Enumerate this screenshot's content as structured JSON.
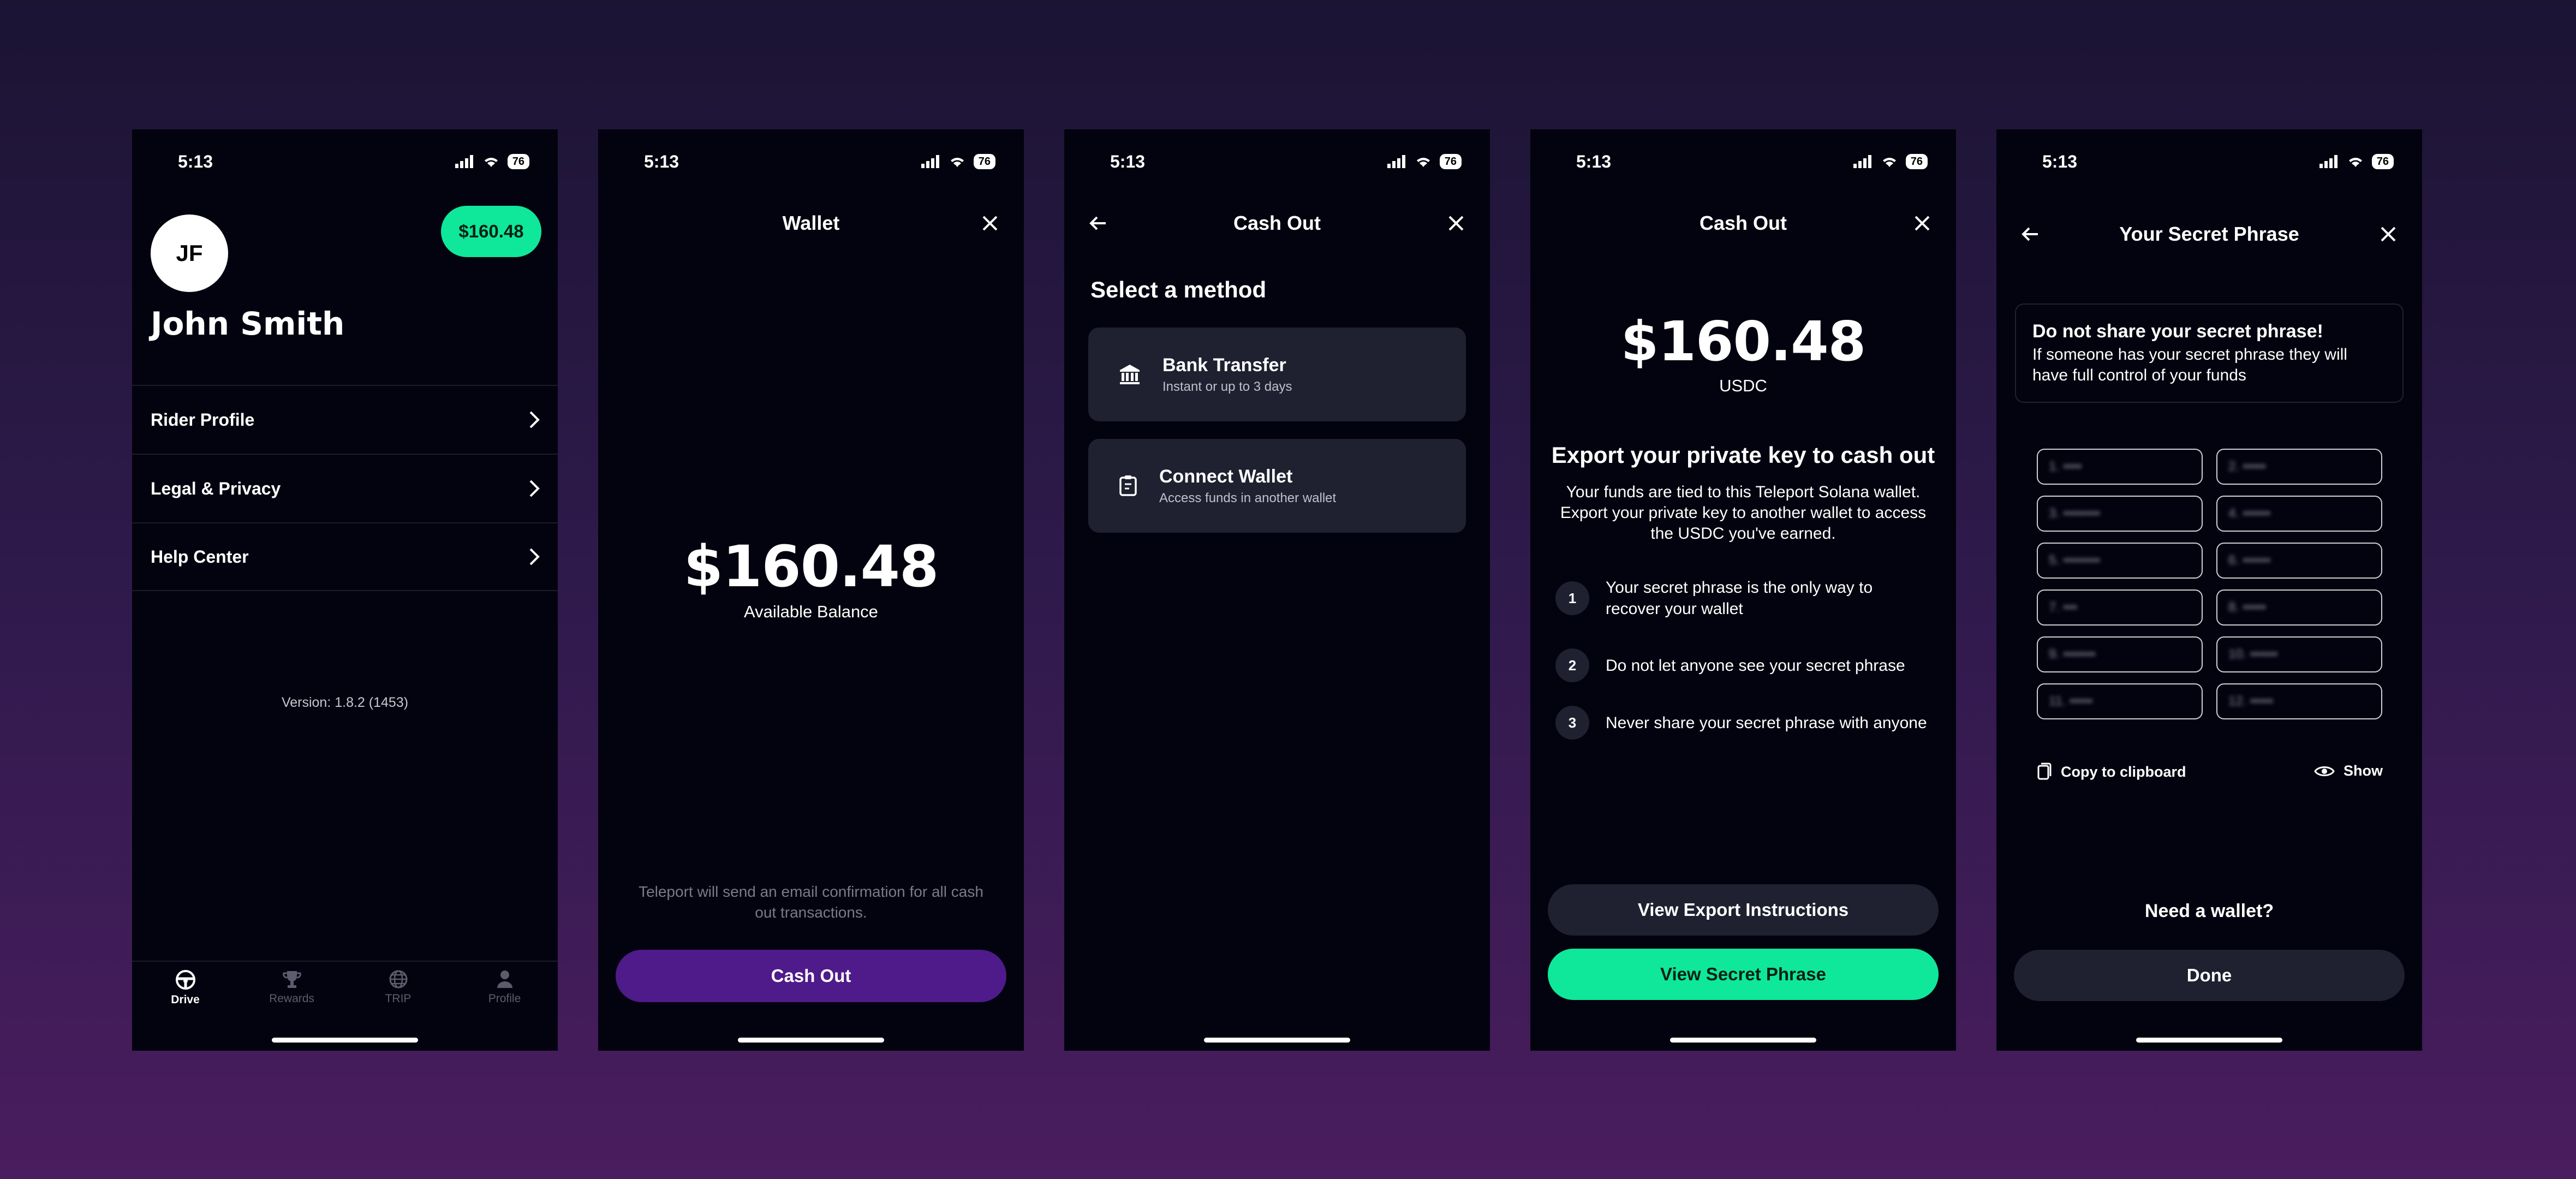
{
  "status": {
    "time": "5:13",
    "battery": "76"
  },
  "profile": {
    "avatar_initials": "JF",
    "balance_badge": "$160.48",
    "name": "John Smith",
    "menu": [
      {
        "label": "Rider Profile"
      },
      {
        "label": "Legal & Privacy"
      },
      {
        "label": "Help Center"
      }
    ],
    "version": "Version: 1.8.2 (1453)",
    "tabs": [
      {
        "label": "Drive",
        "icon": "steering-wheel-icon",
        "active": true
      },
      {
        "label": "Rewards",
        "icon": "trophy-icon",
        "active": false
      },
      {
        "label": "TRIP",
        "icon": "globe-icon",
        "active": false
      },
      {
        "label": "Profile",
        "icon": "person-icon",
        "active": false
      }
    ]
  },
  "wallet": {
    "title": "Wallet",
    "amount": "$160.48",
    "subtitle": "Available Balance",
    "note": "Teleport will send an email confirmation for all cash out transactions.",
    "button": "Cash Out",
    "button_color": "#4f1a8a"
  },
  "cashout_method": {
    "title": "Cash Out",
    "heading": "Select a method",
    "methods": [
      {
        "title": "Bank Transfer",
        "subtitle": "Instant or up to 3 days",
        "icon": "bank-icon"
      },
      {
        "title": "Connect Wallet",
        "subtitle": "Access funds in another wallet",
        "icon": "wallet-icon"
      }
    ]
  },
  "export": {
    "title": "Cash Out",
    "amount": "$160.48",
    "currency": "USDC",
    "heading": "Export your private key to cash out",
    "desc": "Your funds are tied to this Teleport Solana wallet. Export your private key to another wallet to access the USDC you've earned.",
    "steps": [
      {
        "num": "1",
        "text": "Your secret phrase is the only way to recover your wallet"
      },
      {
        "num": "2",
        "text": "Do not let anyone see your secret phrase"
      },
      {
        "num": "3",
        "text": "Never share your secret phrase with anyone"
      }
    ],
    "secondary_button": "View Export Instructions",
    "primary_button": "View Secret Phrase",
    "accent": "#0fe89b"
  },
  "secret": {
    "title": "Your Secret Phrase",
    "warn_title": "Do not share your secret phrase!",
    "warn_text": "If someone has your secret phrase they will have full control of your funds",
    "words": [
      "1. ••••",
      "2. •••••",
      "3. ••••••••",
      "4. ••••••",
      "5. ••••••••",
      "6. ••••••",
      "7. •••",
      "8. •••••",
      "9. •••••••",
      "10. ••••••",
      "11. •••••",
      "12. •••••"
    ],
    "copy": "Copy to clipboard",
    "show": "Show",
    "need_wallet": "Need a wallet?",
    "done": "Done"
  }
}
